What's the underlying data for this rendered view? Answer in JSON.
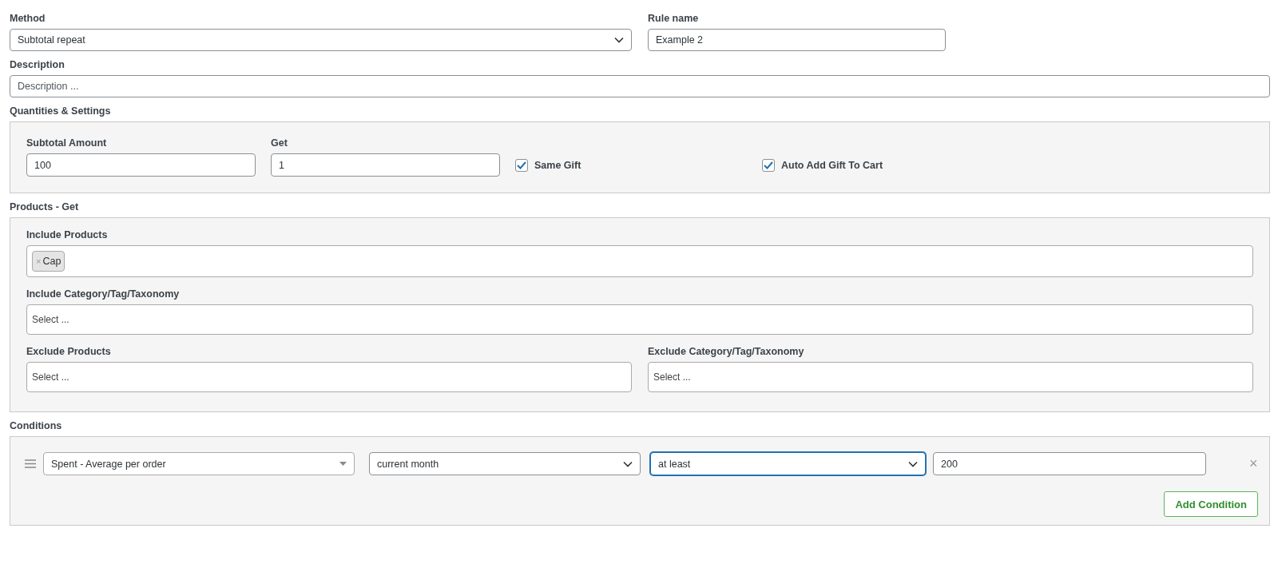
{
  "method": {
    "label": "Method",
    "value": "Subtotal repeat"
  },
  "rule_name": {
    "label": "Rule name",
    "value": "Example 2"
  },
  "description": {
    "label": "Description",
    "placeholder": "Description ..."
  },
  "quantities": {
    "title": "Quantities & Settings",
    "fields": [
      {
        "label": "Subtotal Amount",
        "value": "100"
      },
      {
        "label": "Get",
        "value": "1"
      }
    ],
    "checkboxes": [
      {
        "label": "Same Gift",
        "checked": true
      },
      {
        "label": "Auto Add Gift To Cart",
        "checked": true
      }
    ]
  },
  "products_get": {
    "title": "Products - Get",
    "include_products": {
      "label": "Include Products",
      "tags": [
        {
          "remove": "×",
          "label": "Cap"
        }
      ]
    },
    "include_category": {
      "label": "Include Category/Tag/Taxonomy",
      "placeholder": "Select ..."
    },
    "exclude": [
      {
        "label": "Exclude Products",
        "placeholder": "Select ..."
      },
      {
        "label": "Exclude Category/Tag/Taxonomy",
        "placeholder": "Select ..."
      }
    ]
  },
  "conditions": {
    "title": "Conditions",
    "rows": [
      {
        "remove": "×",
        "fields": [
          {
            "kind": "combo",
            "value": "Spent - Average per order",
            "focused": false
          },
          {
            "kind": "select",
            "value": "current month",
            "focused": false
          },
          {
            "kind": "select",
            "value": "at least",
            "focused": true
          },
          {
            "kind": "input",
            "value": "200",
            "focused": false
          }
        ]
      }
    ],
    "add_button": "Add Condition"
  }
}
